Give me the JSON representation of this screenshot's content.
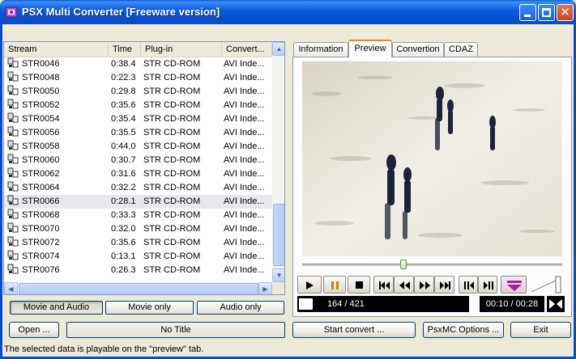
{
  "window": {
    "title": "PSX Multi Converter [Freeware version]",
    "title_color": "#0a5fd8",
    "controls": [
      "minimize-icon",
      "maximize-icon",
      "close-icon"
    ]
  },
  "list": {
    "columns": [
      "Stream",
      "Time",
      "Plug-in",
      "Convert..."
    ],
    "rows": [
      {
        "stream": "STR0046",
        "time": "0:38.4",
        "plugin": "STR CD-ROM",
        "convert": "AVI Inde..."
      },
      {
        "stream": "STR0048",
        "time": "0:22.3",
        "plugin": "STR CD-ROM",
        "convert": "AVI Inde..."
      },
      {
        "stream": "STR0050",
        "time": "0:29.8",
        "plugin": "STR CD-ROM",
        "convert": "AVI Inde..."
      },
      {
        "stream": "STR0052",
        "time": "0:35.6",
        "plugin": "STR CD-ROM",
        "convert": "AVI Inde..."
      },
      {
        "stream": "STR0054",
        "time": "0:35.4",
        "plugin": "STR CD-ROM",
        "convert": "AVI Inde..."
      },
      {
        "stream": "STR0056",
        "time": "0:35.5",
        "plugin": "STR CD-ROM",
        "convert": "AVI Inde..."
      },
      {
        "stream": "STR0058",
        "time": "0:44.0",
        "plugin": "STR CD-ROM",
        "convert": "AVI Inde..."
      },
      {
        "stream": "STR0060",
        "time": "0:30.7",
        "plugin": "STR CD-ROM",
        "convert": "AVI Inde..."
      },
      {
        "stream": "STR0062",
        "time": "0:31.6",
        "plugin": "STR CD-ROM",
        "convert": "AVI Inde..."
      },
      {
        "stream": "STR0064",
        "time": "0:32.2",
        "plugin": "STR CD-ROM",
        "convert": "AVI Inde..."
      },
      {
        "stream": "STR0066",
        "time": "0:28.1",
        "plugin": "STR CD-ROM",
        "convert": "AVI Inde...",
        "selected": true
      },
      {
        "stream": "STR0068",
        "time": "0:33.3",
        "plugin": "STR CD-ROM",
        "convert": "AVI Inde..."
      },
      {
        "stream": "STR0070",
        "time": "0:32.0",
        "plugin": "STR CD-ROM",
        "convert": "AVI Inde..."
      },
      {
        "stream": "STR0072",
        "time": "0:35.6",
        "plugin": "STR CD-ROM",
        "convert": "AVI Inde..."
      },
      {
        "stream": "STR0074",
        "time": "0:13.1",
        "plugin": "STR CD-ROM",
        "convert": "AVI Inde..."
      },
      {
        "stream": "STR0076",
        "time": "0:26.3",
        "plugin": "STR CD-ROM",
        "convert": "AVI Inde..."
      }
    ],
    "selected_stream": "STR0066"
  },
  "modes": {
    "movie_and_audio": "Movie and Audio",
    "movie_only": "Movie only",
    "audio_only": "Audio only",
    "active": "movie_and_audio"
  },
  "buttons": {
    "open": "Open ...",
    "title": "No Title",
    "start_convert": "Start convert ...",
    "options": "PsxMC Options ...",
    "exit": "Exit"
  },
  "tabs": {
    "information": "Information",
    "preview": "Preview",
    "convertion": "Convertion",
    "cdaz": "CDAZ",
    "active": "preview"
  },
  "player": {
    "frame_readout": "164 / 421",
    "time_readout": "00:10 / 00:28",
    "seek_fraction": 0.39,
    "control_icons": [
      "play-icon",
      "pause-icon",
      "stop-icon",
      "skip-start-icon",
      "rewind-icon",
      "fast-forward-icon",
      "skip-end-icon",
      "step-back-icon",
      "step-forward-icon",
      "eject-icon",
      "volume-icon",
      "loop-icon"
    ]
  },
  "status": {
    "text": "The selected data is playable on the \"preview\" tab."
  }
}
